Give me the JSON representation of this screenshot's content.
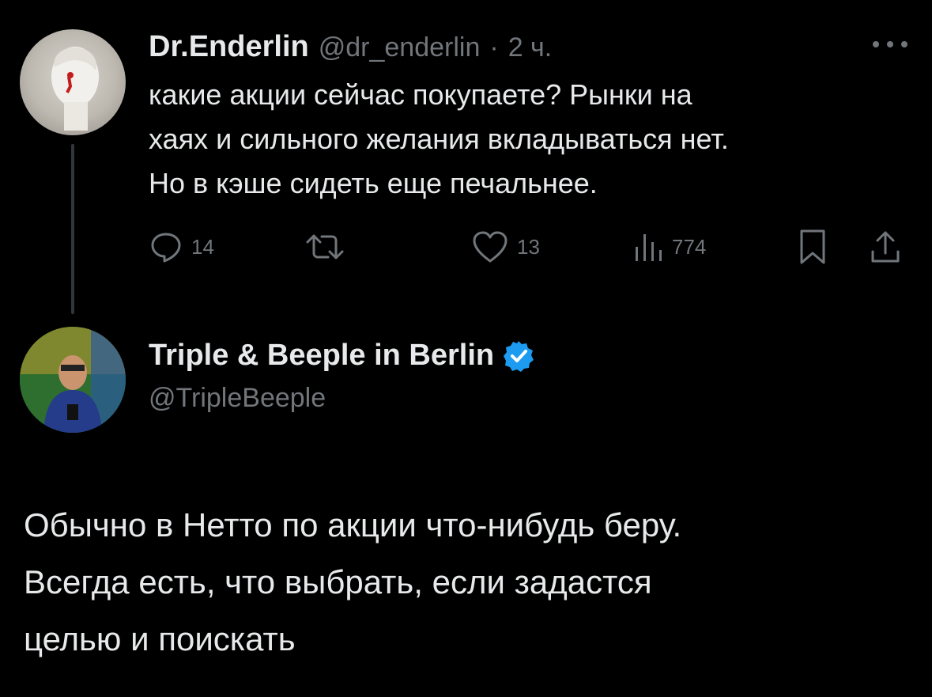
{
  "tweet": {
    "author_name": "Dr.Enderlin",
    "handle": "@dr_enderlin",
    "time_separator": "·",
    "time": "2 ч.",
    "text_lines": [
      "какие акции сейчас покупаете? Рынки на",
      "хаях и сильного желания вкладываться нет.",
      "Но в кэше сидеть еще печальнее."
    ],
    "actions": {
      "replies": "14",
      "likes": "13",
      "views": "774"
    },
    "icons": [
      "more-icon",
      "reply-icon",
      "retweet-icon",
      "like-icon",
      "views-icon",
      "bookmark-icon",
      "share-icon"
    ]
  },
  "reply": {
    "author_name": "Triple & Beeple in Berlin",
    "handle": "@TripleBeeple",
    "verified_color": "#1d9bf0",
    "text_lines": [
      "Обычно в Нетто по акции что-нибудь беру.",
      "Всегда есть, что выбрать, если задастся",
      "целью и поискать"
    ]
  },
  "colors": {
    "background": "#000000",
    "text": "#e7e9ea",
    "muted": "#71767b",
    "accent": "#1d9bf0"
  }
}
